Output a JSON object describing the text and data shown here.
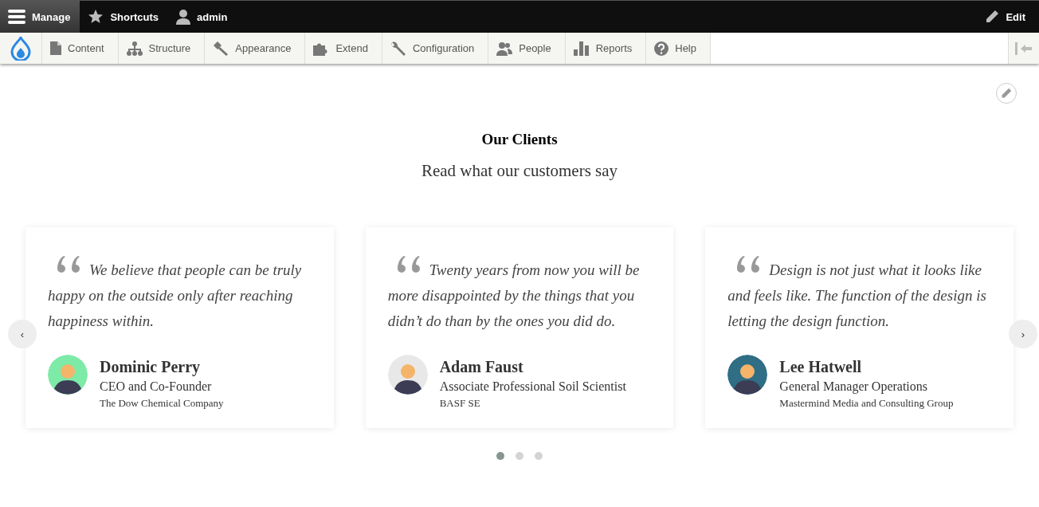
{
  "toolbar": {
    "tabs": [
      {
        "label": "Manage",
        "selected": true
      },
      {
        "label": "Shortcuts",
        "selected": false
      },
      {
        "label": "admin",
        "selected": false
      }
    ],
    "edit": "Edit"
  },
  "admin_menu": {
    "items": [
      {
        "label": "Content"
      },
      {
        "label": "Structure"
      },
      {
        "label": "Appearance"
      },
      {
        "label": "Extend"
      },
      {
        "label": "Configuration"
      },
      {
        "label": "People"
      },
      {
        "label": "Reports"
      },
      {
        "label": "Help"
      }
    ]
  },
  "section": {
    "title": "Our Clients",
    "subtitle": "Read what our customers say"
  },
  "testimonials": [
    {
      "quote": "We believe that people can be truly happy on the outside only after reaching happiness within.",
      "name": "Dominic Perry",
      "role": "CEO and Co-Founder",
      "company": "The Dow Chemical Company",
      "color": "#7deaa8"
    },
    {
      "quote": "Twenty years from now you will be more disappointed by the things that you didn’t do than by the ones you did do.",
      "name": "Adam Faust",
      "role": "Associate Professional Soil Scientist",
      "company": "BASF SE",
      "color": "#e8e8e8"
    },
    {
      "quote": "Design is not just what it looks like and feels like. The function of the design is letting the design function.",
      "name": "Lee Hatwell",
      "role": "General Manager Operations",
      "company": "Mastermind Media and Consulting Group",
      "color": "#2f6e85"
    }
  ],
  "carousel": {
    "prev": "‹",
    "next": "›",
    "dots": [
      {
        "selected": true
      },
      {
        "selected": false
      },
      {
        "selected": false
      }
    ]
  }
}
